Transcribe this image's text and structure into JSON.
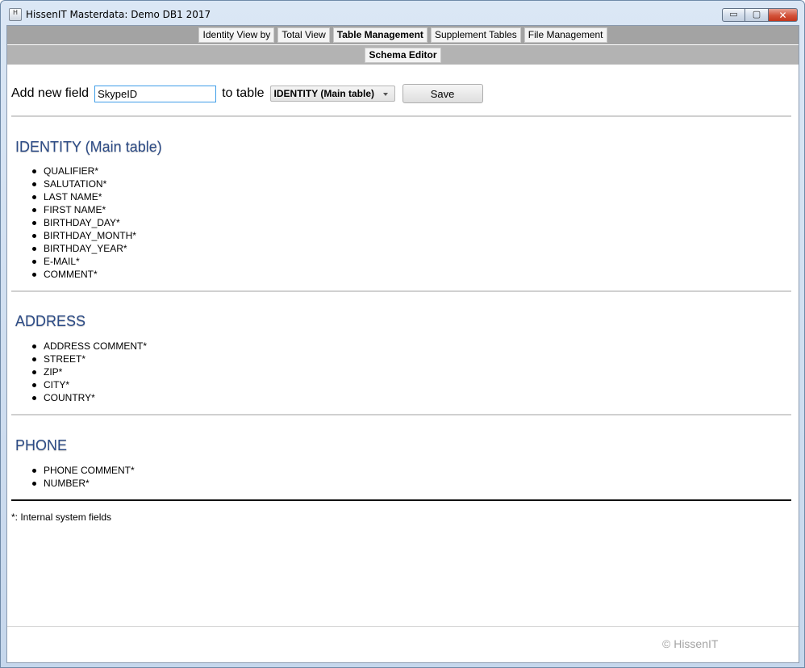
{
  "window": {
    "title": "HissenIT Masterdata: Demo DB1 2017",
    "icon_letter": "H",
    "controls": {
      "minimize": "▭",
      "maximize": "▢",
      "close": "✕"
    }
  },
  "nav": {
    "tabs": [
      {
        "label": "Identity View by",
        "active": false
      },
      {
        "label": "Total View",
        "active": false
      },
      {
        "label": "Table Management",
        "active": true
      },
      {
        "label": "Supplement Tables",
        "active": false
      },
      {
        "label": "File Management",
        "active": false
      }
    ],
    "subtabs": [
      {
        "label": "Schema Editor",
        "active": true
      }
    ]
  },
  "add_field": {
    "label": "Add new field",
    "input_value": "SkypeID",
    "to_table_label": "to table",
    "selected_table": "IDENTITY (Main table)",
    "save_label": "Save"
  },
  "tables": [
    {
      "name": "IDENTITY (Main table)",
      "fields": [
        "QUALIFIER*",
        "SALUTATION*",
        "LAST NAME*",
        "FIRST NAME*",
        "BIRTHDAY_DAY*",
        "BIRTHDAY_MONTH*",
        "BIRTHDAY_YEAR*",
        "E-MAIL*",
        "COMMENT*"
      ]
    },
    {
      "name": "ADDRESS",
      "fields": [
        "ADDRESS COMMENT*",
        "STREET*",
        "ZIP*",
        "CITY*",
        "COUNTRY*"
      ]
    },
    {
      "name": "PHONE",
      "fields": [
        "PHONE COMMENT*",
        "NUMBER*"
      ]
    }
  ],
  "footnote": "*: Internal system fields",
  "copyright": "© HissenIT",
  "colors": {
    "section_title": "#2c4b86",
    "nav_bar": "#a3a3a3",
    "input_focus": "#3f9ee8",
    "close_button": "#c4361c"
  }
}
